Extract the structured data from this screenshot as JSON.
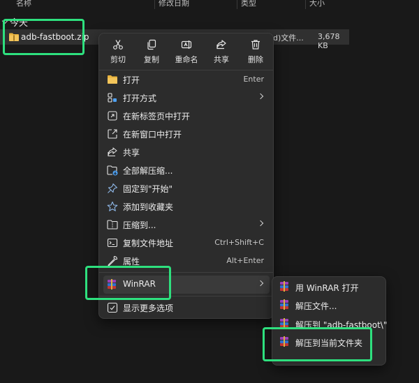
{
  "columns": [
    "名称",
    "修改日期",
    "类型",
    "大小"
  ],
  "group": "今天",
  "file": {
    "name": "adb-fastboot.zip",
    "type": "d)文件...",
    "size": "3,678 KB",
    "icon": "folder-zip-icon"
  },
  "quick_actions": [
    {
      "label": "剪切",
      "icon": "scissors-icon"
    },
    {
      "label": "复制",
      "icon": "copy-icon"
    },
    {
      "label": "重命名",
      "icon": "rename-icon"
    },
    {
      "label": "共享",
      "icon": "share-icon"
    },
    {
      "label": "删除",
      "icon": "trash-icon"
    }
  ],
  "menu": [
    {
      "label": "打开",
      "shortcut": "Enter",
      "icon": "folder-icon"
    },
    {
      "label": "打开方式",
      "submenu": true,
      "icon": "open-with-icon"
    },
    {
      "label": "在新标签页中打开",
      "icon": "new-tab-icon"
    },
    {
      "label": "在新窗口中打开",
      "icon": "new-window-icon"
    },
    {
      "label": "共享",
      "icon": "share-icon"
    },
    {
      "label": "全部解压缩...",
      "icon": "extract-all-icon"
    },
    {
      "label": "固定到\"开始\"",
      "icon": "pin-icon"
    },
    {
      "label": "添加到收藏夹",
      "icon": "star-icon"
    },
    {
      "label": "压缩到...",
      "submenu": true,
      "icon": "compress-icon"
    },
    {
      "label": "复制文件地址",
      "shortcut": "Ctrl+Shift+C",
      "icon": "copy-path-icon"
    },
    {
      "label": "属性",
      "shortcut": "Alt+Enter",
      "icon": "wrench-icon"
    },
    {
      "label": "WinRAR",
      "submenu": true,
      "icon": "winrar-icon"
    },
    {
      "label": "显示更多选项",
      "icon": "more-options-icon"
    }
  ],
  "winrar_submenu": [
    {
      "label": "用 WinRAR 打开"
    },
    {
      "label": "解压文件..."
    },
    {
      "label": "解压到 \"adb-fastboot\\\""
    },
    {
      "label": "解压到当前文件夹"
    }
  ],
  "colors": {
    "background": "#191919",
    "menu": "#2c2c2c",
    "highlight": "#3a3a3a",
    "annotation": "#2ee07e",
    "accent": "#4ea1f3"
  }
}
